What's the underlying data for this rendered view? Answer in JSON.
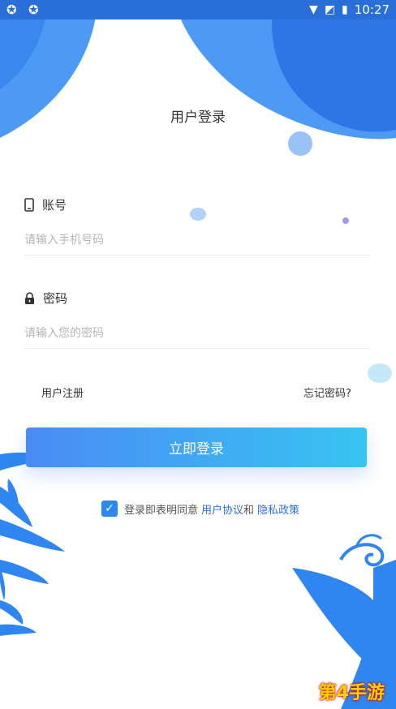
{
  "status_bar": {
    "time": "10:27",
    "icons": [
      "app-icon",
      "app-icon",
      "wifi-icon",
      "no-signal-icon",
      "battery-icon"
    ]
  },
  "page": {
    "title": "用户登录"
  },
  "account": {
    "label": "账号",
    "placeholder": "请输入手机号码"
  },
  "password": {
    "label": "密码",
    "placeholder": "请输入您的密码"
  },
  "links": {
    "register": "用户注册",
    "forgot": "忘记密码?"
  },
  "login_button": "立即登录",
  "agreement": {
    "checked": true,
    "prefix": "登录即表明同意",
    "user_agreement": "用户协议",
    "and": "和",
    "privacy_policy": "隐私政策"
  },
  "watermark": "第4手游",
  "colors": {
    "primary": "#2e88f0",
    "button_start": "#4a8bf4",
    "button_end": "#38c4f2",
    "decor_blue": "#3d8ef0"
  }
}
